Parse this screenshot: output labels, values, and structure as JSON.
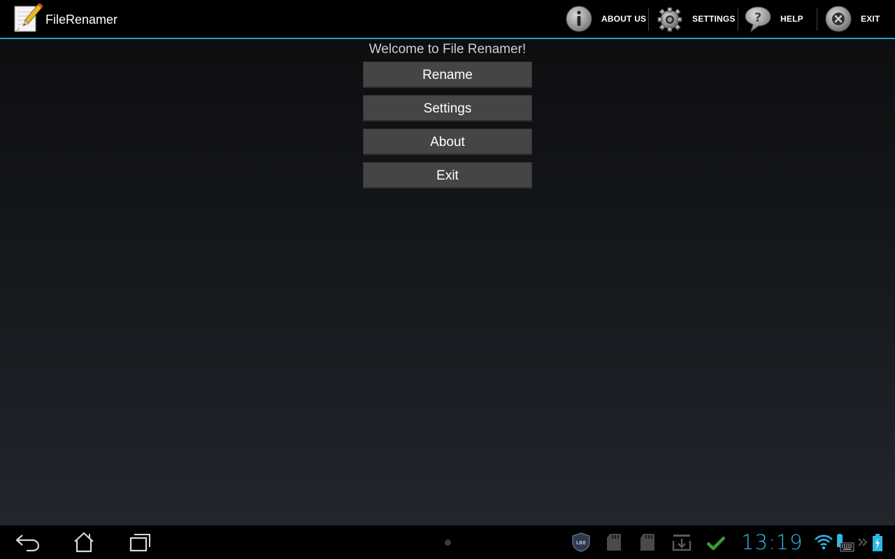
{
  "action_bar": {
    "app_icon": "notepad-pencil-icon",
    "title": "FileRenamer",
    "actions": [
      {
        "label": "ABOUT US",
        "icon": "info-icon"
      },
      {
        "label": "SETTINGS",
        "icon": "gear-icon"
      },
      {
        "label": "HELP",
        "icon": "help-bubble-icon"
      },
      {
        "label": "EXIT",
        "icon": "close-circle-icon"
      }
    ],
    "accent_color": "#2f9ec8"
  },
  "main": {
    "welcome": "Welcome to File Renamer!",
    "buttons": [
      {
        "label": "Rename"
      },
      {
        "label": "Settings"
      },
      {
        "label": "About"
      },
      {
        "label": "Exit"
      }
    ]
  },
  "system_bar": {
    "nav": [
      "back-icon",
      "home-icon",
      "recent-apps-icon"
    ],
    "status_icons": [
      "lbe-shield-icon",
      "sd-card-icon",
      "sd-card-icon",
      "download-icon",
      "checkmark-icon",
      "wifi-icon",
      "keyboard-icon",
      "more-icon",
      "battery-icon"
    ],
    "clock": "13:19",
    "clock_color": "#33b5e5",
    "lbe_label": "LBE"
  }
}
